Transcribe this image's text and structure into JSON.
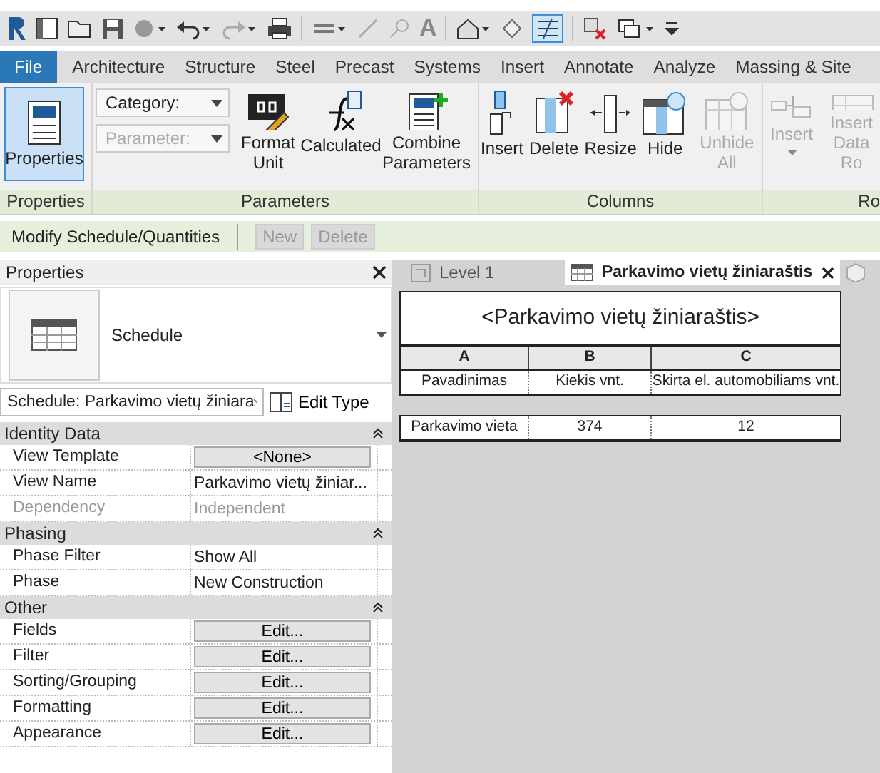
{
  "quick_access": {
    "text_tool_glyph": "A"
  },
  "ribbon_tabs": [
    {
      "label": "File",
      "kind": "file"
    },
    {
      "label": "Architecture",
      "kind": "tab"
    },
    {
      "label": "Structure",
      "kind": "tab"
    },
    {
      "label": "Steel",
      "kind": "tab"
    },
    {
      "label": "Precast",
      "kind": "tab"
    },
    {
      "label": "Systems",
      "kind": "tab"
    },
    {
      "label": "Insert",
      "kind": "tab"
    },
    {
      "label": "Annotate",
      "kind": "tab"
    },
    {
      "label": "Analyze",
      "kind": "tab"
    },
    {
      "label": "Massing & Site",
      "kind": "tab"
    }
  ],
  "ribbon_panels": [
    {
      "label": "Properties",
      "buttons": [
        {
          "label": "Properties",
          "selected": true,
          "disabled": false
        }
      ]
    },
    {
      "label": "Parameters",
      "dropdowns": [
        {
          "label": "Category:",
          "disabled": false
        },
        {
          "label": "Parameter:",
          "disabled": true
        }
      ],
      "buttons": [
        {
          "label": "Format Unit",
          "selected": false,
          "disabled": false
        },
        {
          "label": "Calculated",
          "selected": false,
          "disabled": false
        },
        {
          "label": "Combine Parameters",
          "selected": false,
          "disabled": false
        }
      ]
    },
    {
      "label": "Columns",
      "buttons": [
        {
          "label": "Insert",
          "selected": false,
          "disabled": false
        },
        {
          "label": "Delete",
          "selected": false,
          "disabled": false
        },
        {
          "label": "Resize",
          "selected": false,
          "disabled": false
        },
        {
          "label": "Hide",
          "selected": false,
          "disabled": false
        },
        {
          "label": "Unhide All",
          "selected": false,
          "disabled": true
        }
      ]
    },
    {
      "label": "Ro",
      "buttons": [
        {
          "label": "Insert",
          "selected": false,
          "disabled": true
        },
        {
          "label": "Insert Data Ro",
          "selected": false,
          "disabled": true
        }
      ]
    }
  ],
  "context_bar": {
    "title": "Modify Schedule/Quantities",
    "buttons": [
      {
        "label": "New",
        "disabled": true
      },
      {
        "label": "Delete",
        "disabled": true
      }
    ]
  },
  "properties": {
    "title": "Properties",
    "type_name": "Schedule",
    "selector": "Schedule: Parkavimo vietų žiniara",
    "edit_type": "Edit Type",
    "groups": [
      {
        "title": "Identity Data",
        "expanded": true,
        "rows": [
          {
            "name": "View Template",
            "value": "<None>",
            "kind": "button",
            "disabled": false
          },
          {
            "name": "View Name",
            "value": "Parkavimo vietų žiniar...",
            "kind": "text",
            "disabled": false
          },
          {
            "name": "Dependency",
            "value": "Independent",
            "kind": "text",
            "disabled": true
          }
        ]
      },
      {
        "title": "Phasing",
        "expanded": true,
        "rows": [
          {
            "name": "Phase Filter",
            "value": "Show All",
            "kind": "text",
            "disabled": false
          },
          {
            "name": "Phase",
            "value": "New Construction",
            "kind": "text",
            "disabled": false
          }
        ]
      },
      {
        "title": "Other",
        "expanded": true,
        "rows": [
          {
            "name": "Fields",
            "value": "Edit...",
            "kind": "button",
            "disabled": false
          },
          {
            "name": "Filter",
            "value": "Edit...",
            "kind": "button",
            "disabled": false
          },
          {
            "name": "Sorting/Grouping",
            "value": "Edit...",
            "kind": "button",
            "disabled": false
          },
          {
            "name": "Formatting",
            "value": "Edit...",
            "kind": "button",
            "disabled": false
          },
          {
            "name": "Appearance",
            "value": "Edit...",
            "kind": "button",
            "disabled": false
          }
        ]
      }
    ]
  },
  "view_tabs": [
    {
      "label": "Level 1",
      "selected": false
    },
    {
      "label": "Parkavimo vietų žiniaraštis",
      "selected": true
    }
  ],
  "schedule": {
    "title": "<Parkavimo vietų žiniaraštis>",
    "columns": [
      "A",
      "B",
      "C"
    ],
    "headers": [
      "Pavadinimas",
      "Kiekis vnt.",
      "Skirta el. automobiliams vnt."
    ],
    "rows": [
      [
        "Parkavimo vieta",
        "374",
        "12"
      ]
    ]
  }
}
